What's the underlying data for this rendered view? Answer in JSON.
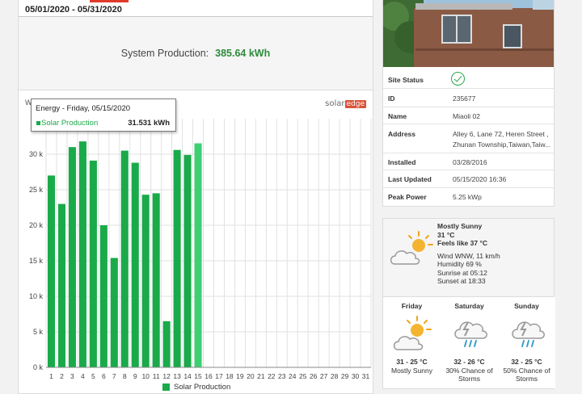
{
  "period": {
    "date_range": "05/01/2020 - 05/31/2020"
  },
  "production": {
    "label": "System Production:",
    "value": "385.64 kWh"
  },
  "chart_data": {
    "type": "bar",
    "title": "",
    "ylabel": "W",
    "xlabel": "",
    "ylim": [
      0,
      35000
    ],
    "yticks": [
      0,
      5000,
      10000,
      15000,
      20000,
      25000,
      30000
    ],
    "ytick_labels": [
      "0 k",
      "5 k",
      "10 k",
      "15 k",
      "20 k",
      "25 k",
      "30 k"
    ],
    "categories": [
      "1",
      "2",
      "3",
      "4",
      "5",
      "6",
      "7",
      "8",
      "9",
      "10",
      "11",
      "12",
      "13",
      "14",
      "15",
      "16",
      "17",
      "18",
      "19",
      "20",
      "21",
      "22",
      "23",
      "24",
      "25",
      "26",
      "27",
      "28",
      "29",
      "30",
      "31"
    ],
    "series": [
      {
        "name": "Solar Production",
        "values": [
          27000,
          23000,
          31000,
          31800,
          29100,
          20000,
          15400,
          30500,
          28800,
          24300,
          24500,
          6500,
          30600,
          29900,
          31531,
          null,
          null,
          null,
          null,
          null,
          null,
          null,
          null,
          null,
          null,
          null,
          null,
          null,
          null,
          null,
          null
        ]
      }
    ],
    "highlight_index": 14,
    "colors": {
      "bar": "#1aaa4a",
      "highlight": "#3fcf73",
      "grid": "#e2e2e2"
    },
    "legend": "bottom-center",
    "tooltip": {
      "title": "Energy - Friday, 05/15/2020",
      "series": "Solar Production",
      "value": "31.531 kWh"
    }
  },
  "brand": {
    "logo_text": "solar",
    "logo_accent": "edge"
  },
  "site": {
    "rows": [
      {
        "key": "Site Status",
        "value": ""
      },
      {
        "key": "ID",
        "value": "235677"
      },
      {
        "key": "Name",
        "value": "Miaoli 02"
      },
      {
        "key": "Address",
        "value": "Alley 6, Lane 72, Heren Street , Zhunan Township,Taiwan,Taiw..."
      },
      {
        "key": "Installed",
        "value": "03/28/2016"
      },
      {
        "key": "Last Updated",
        "value": "05/15/2020 16:36"
      },
      {
        "key": "Peak Power",
        "value": "5.25 kWp"
      }
    ],
    "status_icon": "check-circle-icon"
  },
  "weather": {
    "now": {
      "condition": "Mostly Sunny",
      "temp": "31 °C",
      "feels": "Feels like 37 °C",
      "wind": "Wind WNW, 11 km/h",
      "humidity": "Humidity 69 %",
      "sunrise": "Sunrise at 05:12",
      "sunset": "Sunset at 18:33",
      "icon": "partly-sunny-icon"
    },
    "forecast": [
      {
        "day": "Friday",
        "temp": "31 - 25 °C",
        "desc": "Mostly Sunny",
        "icon": "partly-sunny-icon"
      },
      {
        "day": "Saturday",
        "temp": "32 - 26 °C",
        "desc": "30% Chance of Storms",
        "icon": "storm-icon"
      },
      {
        "day": "Sunday",
        "temp": "32 - 25 °C",
        "desc": "50% Chance of Storms",
        "icon": "storm-icon"
      }
    ]
  }
}
